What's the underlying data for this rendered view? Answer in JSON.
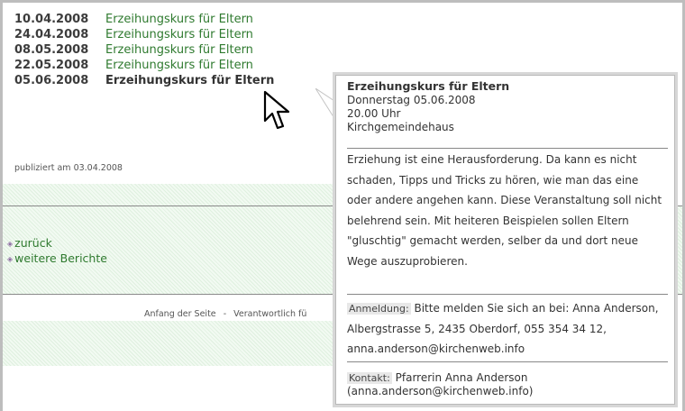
{
  "events": [
    {
      "date": "10.04.2008",
      "title": "Erzeihungskurs für Eltern"
    },
    {
      "date": "24.04.2008",
      "title": "Erzeihungskurs für Eltern"
    },
    {
      "date": "08.05.2008",
      "title": "Erzeihungskurs für Eltern"
    },
    {
      "date": "22.05.2008",
      "title": "Erzeihungskurs für Eltern"
    },
    {
      "date": "05.06.2008",
      "title": "Erzeihungskurs für Eltern"
    }
  ],
  "published": "publiziert am 03.04.2008",
  "nav": {
    "back": "zurück",
    "more": "weitere Berichte"
  },
  "footer": {
    "top_link": "Anfang der Seite",
    "separator": "-",
    "responsible": "Verantwortlich fü"
  },
  "tooltip": {
    "title": "Erzeihungskurs für Eltern",
    "date": "Donnerstag 05.06.2008",
    "time": "20.00 Uhr",
    "place": "Kirchgemeindehaus",
    "description": "Erziehung ist eine Herausforderung. Da kann es nicht schaden, Tipps und Tricks zu hören, wie man das eine oder andere angehen kann. Diese Veranstaltung soll nicht belehrend sein. Mit heiteren Beispielen sollen Eltern \"gluschtig\" gemacht werden, selber da und dort neue Wege auszuprobieren.",
    "registration_label": "Anmeldung:",
    "registration_text": "Bitte melden Sie sich an bei: Anna Anderson, Albergstrasse 5, 2435 Oberdorf, 055 354 34 12, anna.anderson@kirchenweb.info",
    "contact_label": "Kontakt:",
    "contact_text": "Pfarrerin Anna Anderson (anna.anderson@kirchenweb.info)"
  },
  "colors": {
    "link_green": "#2f7a2f",
    "hatch_green": "#dff0df"
  }
}
